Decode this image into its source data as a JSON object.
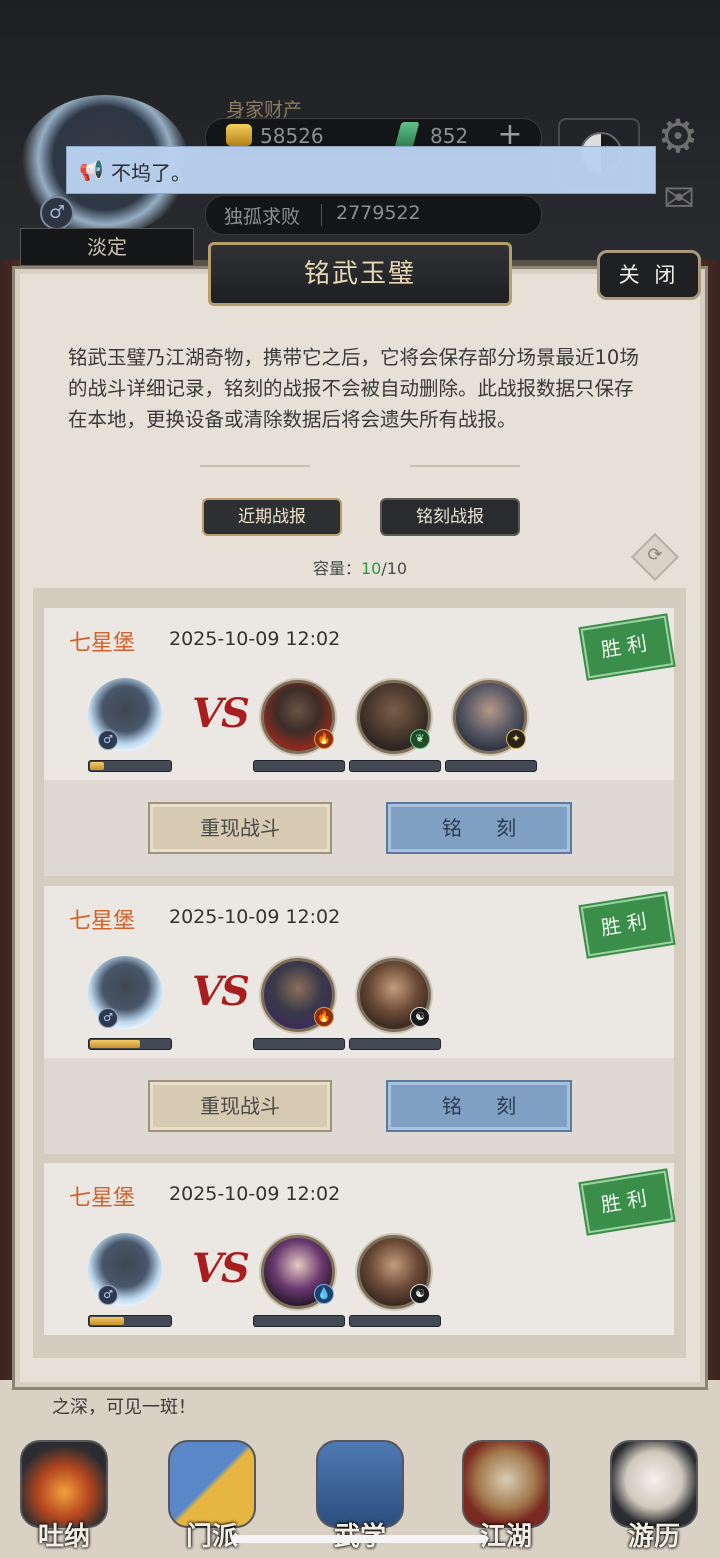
{
  "header": {
    "wealth_title": "身家财产",
    "gold": "58526",
    "jade": "852",
    "plus": "+",
    "player_name": "淡定",
    "rank_title": "独孤求败",
    "rank_value": "2779522"
  },
  "announcement": {
    "text": "不坞了。"
  },
  "modal": {
    "title": "铭武玉璧",
    "close_label": "关 闭",
    "description": "铭武玉璧乃江湖奇物，携带它之后，它将会保存部分场景最近10场的战斗详细记录，铭刻的战报不会被自动删除。此战报数据只保存在本地，更换设备或清除数据后将会遗失所有战报。",
    "tabs": {
      "recent": "近期战报",
      "engraved": "铭刻战报"
    },
    "capacity": {
      "label": "容量：",
      "used": "10",
      "total": "/10"
    }
  },
  "records": [
    {
      "location": "七星堡",
      "time": "2025-10-09 12:02",
      "result": "胜利",
      "vs": "VS",
      "self_hp": 0.18,
      "enemies": [
        {
          "name": "enemy-a",
          "badge": "fire"
        },
        {
          "name": "enemy-b",
          "badge": "leaf"
        },
        {
          "name": "enemy-c",
          "badge": "gold"
        }
      ],
      "replay_label": "重现战斗",
      "engrave_label": "铭 刻"
    },
    {
      "location": "七星堡",
      "time": "2025-10-09 12:02",
      "result": "胜利",
      "vs": "VS",
      "self_hp": 0.62,
      "enemies": [
        {
          "name": "enemy-d",
          "badge": "fire"
        },
        {
          "name": "enemy-e",
          "badge": "taiji"
        }
      ],
      "replay_label": "重现战斗",
      "engrave_label": "铭 刻"
    },
    {
      "location": "七星堡",
      "time": "2025-10-09 12:02",
      "result": "胜利",
      "vs": "VS",
      "self_hp": 0.42,
      "enemies": [
        {
          "name": "enemy-f",
          "badge": "water"
        },
        {
          "name": "enemy-g",
          "badge": "taiji"
        }
      ]
    }
  ],
  "story_text": "之深，可见一斑！",
  "nav": [
    {
      "label": "吐纳"
    },
    {
      "label": "门派"
    },
    {
      "label": "武学"
    },
    {
      "label": "江湖"
    },
    {
      "label": "游历"
    }
  ],
  "colors": {
    "location": "#d2622c",
    "win": "#3a8e49",
    "capacity_used": "#2f9a3a",
    "vs": "#a81d1d",
    "engrave_button": "#7f9fc3"
  }
}
